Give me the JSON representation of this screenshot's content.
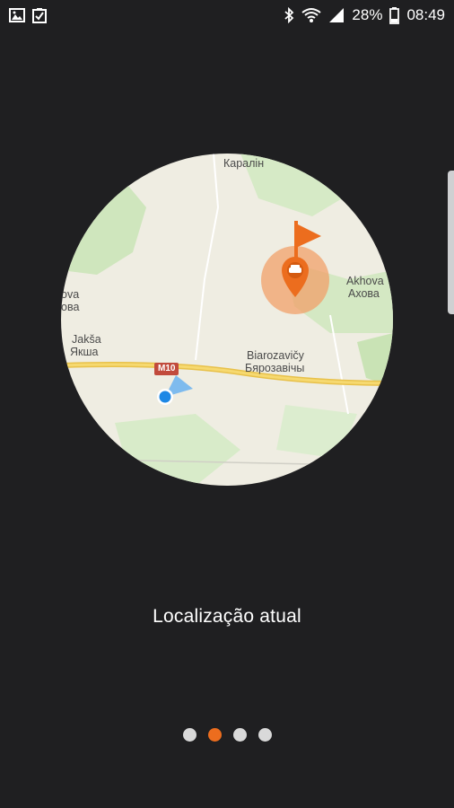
{
  "status_bar": {
    "battery_percent": "28%",
    "time": "08:49",
    "icons_left": [
      "image-icon",
      "checklist-icon"
    ],
    "icons_right": [
      "bluetooth-icon",
      "wifi-icon",
      "signal-icon",
      "battery-icon"
    ]
  },
  "map": {
    "labels": {
      "karalin": "Каралін",
      "akhova_latin": "Akhova",
      "akhova_cyr": "Ахова",
      "jaksa_latin": "Jakša",
      "jaksa_cyr": "Якша",
      "biarozavicy_latin": "Biarozavičy",
      "biarozavicy_cyr": "Бярозавічы",
      "left_partial_1": "ova",
      "left_partial_2": "ова"
    },
    "road_shield": "M10",
    "colors": {
      "land": "#efede2",
      "forest": "#c9e3b5",
      "road": "#f0cc5a",
      "accent": "#ec6d1e",
      "user_location": "#1e88e5"
    }
  },
  "caption": "Localização atual",
  "pagination": {
    "count": 4,
    "active_index": 1
  }
}
